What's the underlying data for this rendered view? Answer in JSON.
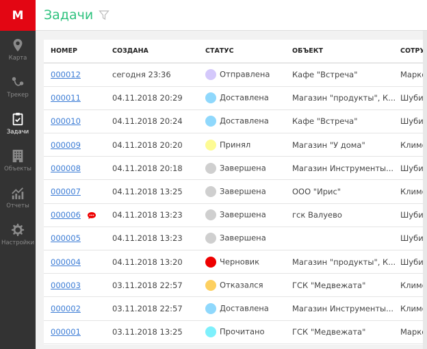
{
  "logo": "M",
  "sidebar": {
    "items": [
      {
        "label": "Карта",
        "icon": "map-pin-icon",
        "active": false
      },
      {
        "label": "Трекер",
        "icon": "route-icon",
        "active": false
      },
      {
        "label": "Задачи",
        "icon": "clipboard-check-icon",
        "active": true
      },
      {
        "label": "Объекты",
        "icon": "building-icon",
        "active": false
      },
      {
        "label": "Отчеты",
        "icon": "chart-icon",
        "active": false
      },
      {
        "label": "Настройки",
        "icon": "gear-icon",
        "active": false
      }
    ]
  },
  "header": {
    "title": "Задачи",
    "filter_icon": "filter-icon"
  },
  "table": {
    "columns": [
      "НОМЕР",
      "СОЗДАНА",
      "СТАТУС",
      "ОБЪЕКТ",
      "СОТРУ"
    ],
    "rows": [
      {
        "number": "000012",
        "created": "сегодня 23:36",
        "status": "Отправлена",
        "color": "#d4c8fb",
        "object": "Кафе \"Встреча\"",
        "employee": "Марко"
      },
      {
        "number": "000011",
        "created": "04.11.2018 20:29",
        "status": "Доставлена",
        "color": "#8fd8fc",
        "object": "Магазин \"продукты\", К...",
        "employee": "Шубин"
      },
      {
        "number": "000010",
        "created": "04.11.2018 20:24",
        "status": "Доставлена",
        "color": "#8fd8fc",
        "object": "Кафе \"Встреча\"",
        "employee": "Шубин"
      },
      {
        "number": "000009",
        "created": "04.11.2018 20:20",
        "status": "Принял",
        "color": "#fdfb94",
        "object": "Магазин \"У дома\"",
        "employee": "Климо"
      },
      {
        "number": "000008",
        "created": "04.11.2018 20:18",
        "status": "Завершена",
        "color": "#cfcfcf",
        "object": "Магазин Инструменты...",
        "employee": "Шубин"
      },
      {
        "number": "000007",
        "created": "04.11.2018 13:25",
        "status": "Завершена",
        "color": "#cfcfcf",
        "object": "ООО \"Ирис\"",
        "employee": "Климо"
      },
      {
        "number": "000006",
        "created": "04.11.2018 13:23",
        "status": "Завершена",
        "color": "#cfcfcf",
        "object": "гск Валуево",
        "employee": "Шубин",
        "has_message": true
      },
      {
        "number": "000005",
        "created": "04.11.2018 13:23",
        "status": "Завершена",
        "color": "#cfcfcf",
        "object": "",
        "employee": "Шубин"
      },
      {
        "number": "000004",
        "created": "04.11.2018 13:20",
        "status": "Черновик",
        "color": "#ee0000",
        "object": "Магазин \"продукты\", К...",
        "employee": "Шубин"
      },
      {
        "number": "000003",
        "created": "03.11.2018 22:57",
        "status": "Отказался",
        "color": "#fdd060",
        "object": "ГСК \"Медвежата\"",
        "employee": "Климо"
      },
      {
        "number": "000002",
        "created": "03.11.2018 22:57",
        "status": "Доставлена",
        "color": "#8fd8fc",
        "object": "Магазин Инструменты...",
        "employee": "Климо"
      },
      {
        "number": "000001",
        "created": "03.11.2018 13:25",
        "status": "Прочитано",
        "color": "#7ef0fc",
        "object": "ГСК \"Медвежата\"",
        "employee": "Марко"
      }
    ]
  },
  "colors": {
    "brand": "#e30613",
    "title": "#2ec27e",
    "sidebar": "#333333",
    "link": "#3a7bd5"
  }
}
